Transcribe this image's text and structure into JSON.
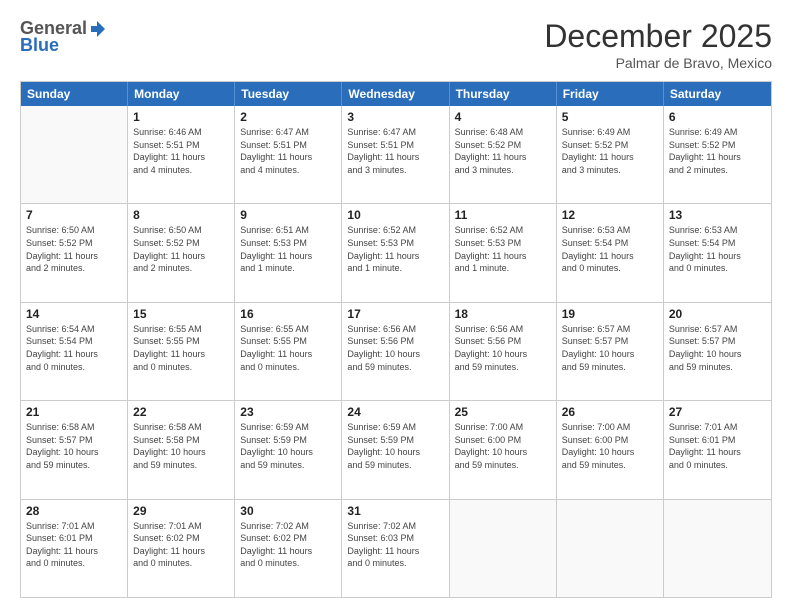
{
  "header": {
    "logo": {
      "general": "General",
      "blue": "Blue",
      "icon": "▶"
    },
    "title": "December 2025",
    "subtitle": "Palmar de Bravo, Mexico"
  },
  "weekdays": [
    "Sunday",
    "Monday",
    "Tuesday",
    "Wednesday",
    "Thursday",
    "Friday",
    "Saturday"
  ],
  "weeks": [
    [
      {
        "day": null,
        "info": null
      },
      {
        "day": "1",
        "info": "Sunrise: 6:46 AM\nSunset: 5:51 PM\nDaylight: 11 hours\nand 4 minutes."
      },
      {
        "day": "2",
        "info": "Sunrise: 6:47 AM\nSunset: 5:51 PM\nDaylight: 11 hours\nand 4 minutes."
      },
      {
        "day": "3",
        "info": "Sunrise: 6:47 AM\nSunset: 5:51 PM\nDaylight: 11 hours\nand 3 minutes."
      },
      {
        "day": "4",
        "info": "Sunrise: 6:48 AM\nSunset: 5:52 PM\nDaylight: 11 hours\nand 3 minutes."
      },
      {
        "day": "5",
        "info": "Sunrise: 6:49 AM\nSunset: 5:52 PM\nDaylight: 11 hours\nand 3 minutes."
      },
      {
        "day": "6",
        "info": "Sunrise: 6:49 AM\nSunset: 5:52 PM\nDaylight: 11 hours\nand 2 minutes."
      }
    ],
    [
      {
        "day": "7",
        "info": "Sunrise: 6:50 AM\nSunset: 5:52 PM\nDaylight: 11 hours\nand 2 minutes."
      },
      {
        "day": "8",
        "info": "Sunrise: 6:50 AM\nSunset: 5:52 PM\nDaylight: 11 hours\nand 2 minutes."
      },
      {
        "day": "9",
        "info": "Sunrise: 6:51 AM\nSunset: 5:53 PM\nDaylight: 11 hours\nand 1 minute."
      },
      {
        "day": "10",
        "info": "Sunrise: 6:52 AM\nSunset: 5:53 PM\nDaylight: 11 hours\nand 1 minute."
      },
      {
        "day": "11",
        "info": "Sunrise: 6:52 AM\nSunset: 5:53 PM\nDaylight: 11 hours\nand 1 minute."
      },
      {
        "day": "12",
        "info": "Sunrise: 6:53 AM\nSunset: 5:54 PM\nDaylight: 11 hours\nand 0 minutes."
      },
      {
        "day": "13",
        "info": "Sunrise: 6:53 AM\nSunset: 5:54 PM\nDaylight: 11 hours\nand 0 minutes."
      }
    ],
    [
      {
        "day": "14",
        "info": "Sunrise: 6:54 AM\nSunset: 5:54 PM\nDaylight: 11 hours\nand 0 minutes."
      },
      {
        "day": "15",
        "info": "Sunrise: 6:55 AM\nSunset: 5:55 PM\nDaylight: 11 hours\nand 0 minutes."
      },
      {
        "day": "16",
        "info": "Sunrise: 6:55 AM\nSunset: 5:55 PM\nDaylight: 11 hours\nand 0 minutes."
      },
      {
        "day": "17",
        "info": "Sunrise: 6:56 AM\nSunset: 5:56 PM\nDaylight: 10 hours\nand 59 minutes."
      },
      {
        "day": "18",
        "info": "Sunrise: 6:56 AM\nSunset: 5:56 PM\nDaylight: 10 hours\nand 59 minutes."
      },
      {
        "day": "19",
        "info": "Sunrise: 6:57 AM\nSunset: 5:57 PM\nDaylight: 10 hours\nand 59 minutes."
      },
      {
        "day": "20",
        "info": "Sunrise: 6:57 AM\nSunset: 5:57 PM\nDaylight: 10 hours\nand 59 minutes."
      }
    ],
    [
      {
        "day": "21",
        "info": "Sunrise: 6:58 AM\nSunset: 5:57 PM\nDaylight: 10 hours\nand 59 minutes."
      },
      {
        "day": "22",
        "info": "Sunrise: 6:58 AM\nSunset: 5:58 PM\nDaylight: 10 hours\nand 59 minutes."
      },
      {
        "day": "23",
        "info": "Sunrise: 6:59 AM\nSunset: 5:59 PM\nDaylight: 10 hours\nand 59 minutes."
      },
      {
        "day": "24",
        "info": "Sunrise: 6:59 AM\nSunset: 5:59 PM\nDaylight: 10 hours\nand 59 minutes."
      },
      {
        "day": "25",
        "info": "Sunrise: 7:00 AM\nSunset: 6:00 PM\nDaylight: 10 hours\nand 59 minutes."
      },
      {
        "day": "26",
        "info": "Sunrise: 7:00 AM\nSunset: 6:00 PM\nDaylight: 10 hours\nand 59 minutes."
      },
      {
        "day": "27",
        "info": "Sunrise: 7:01 AM\nSunset: 6:01 PM\nDaylight: 11 hours\nand 0 minutes."
      }
    ],
    [
      {
        "day": "28",
        "info": "Sunrise: 7:01 AM\nSunset: 6:01 PM\nDaylight: 11 hours\nand 0 minutes."
      },
      {
        "day": "29",
        "info": "Sunrise: 7:01 AM\nSunset: 6:02 PM\nDaylight: 11 hours\nand 0 minutes."
      },
      {
        "day": "30",
        "info": "Sunrise: 7:02 AM\nSunset: 6:02 PM\nDaylight: 11 hours\nand 0 minutes."
      },
      {
        "day": "31",
        "info": "Sunrise: 7:02 AM\nSunset: 6:03 PM\nDaylight: 11 hours\nand 0 minutes."
      },
      {
        "day": null,
        "info": null
      },
      {
        "day": null,
        "info": null
      },
      {
        "day": null,
        "info": null
      }
    ]
  ]
}
